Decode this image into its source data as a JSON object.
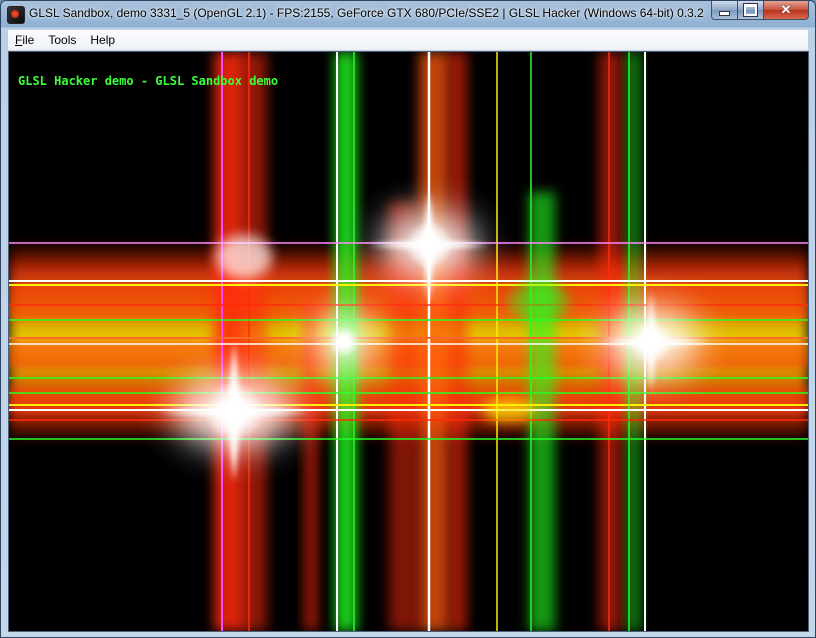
{
  "window": {
    "title": "GLSL Sandbox, demo 3331_5 (OpenGL 2.1) - FPS:2155, GeForce GTX 680/PCIe/SSE2 | GLSL Hacker (Windows 64-bit) 0.3.2",
    "icon": "glsl-hacker-app-icon"
  },
  "caption_buttons": {
    "minimize": "minimize-icon",
    "maximize": "maximize-icon",
    "close": "close-icon",
    "close_glyph": "✕"
  },
  "menu": {
    "items": [
      {
        "label_first": "F",
        "label_rest": "ile"
      },
      {
        "label_first": "",
        "label_rest": "Tools"
      },
      {
        "label_first": "",
        "label_rest": "Help"
      }
    ]
  },
  "viewport": {
    "overlay_text": "GLSL Hacker demo - GLSL Sandbox demo",
    "overlay_color": "#3bff3b",
    "scene_colors": {
      "background": "#000000",
      "white": "#ffffff",
      "red": "#ff2a0a",
      "yellow": "#ffee00",
      "green": "#22ff22",
      "magenta": "#ff44ff"
    }
  }
}
